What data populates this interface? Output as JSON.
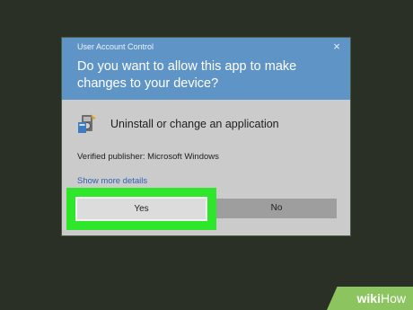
{
  "dialog": {
    "title": "User Account Control",
    "close_label": "×",
    "question": "Do you want to allow this app to make changes to your device?",
    "app_name": "Uninstall or change an application",
    "app_icon": "control-panel-program-icon",
    "publisher": "Verified publisher: Microsoft Windows",
    "more_details": "Show more details",
    "yes_label": "Yes",
    "no_label": "No"
  },
  "watermark": {
    "part1": "wiki",
    "part2": "How"
  },
  "colors": {
    "header": "#5f95c6",
    "body": "#cbcbcb",
    "highlight": "#2ee62a",
    "background": "#2b3027"
  }
}
